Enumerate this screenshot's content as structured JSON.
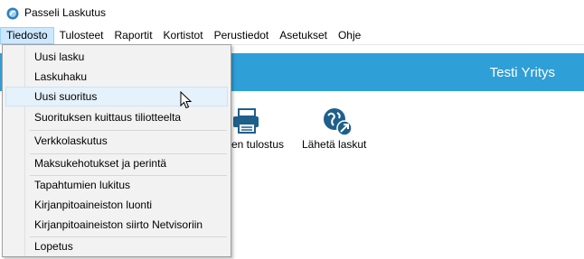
{
  "window": {
    "title": "Passeli Laskutus"
  },
  "menubar": {
    "items": [
      "Tiedosto",
      "Tulosteet",
      "Raportit",
      "Kortistot",
      "Perustiedot",
      "Asetukset",
      "Ohje"
    ]
  },
  "banner": {
    "company": "Testi Yritys",
    "color": "#2f9fd8"
  },
  "toolbar": {
    "print_label": "en tulostus",
    "send_label": "Lähetä laskut"
  },
  "file_menu": {
    "items": [
      "Uusi lasku",
      "Laskuhaku",
      "Uusi suoritus",
      "Suorituksen kuittaus tiliotteelta",
      "Verkkolaskutus",
      "Maksukehotukset ja perintä",
      "Tapahtumien lukitus",
      "Kirjanpitoaineiston luonti",
      "Kirjanpitoaineiston siirto Netvisoriin",
      "Lopetus"
    ],
    "hovered": "Uusi suoritus"
  }
}
